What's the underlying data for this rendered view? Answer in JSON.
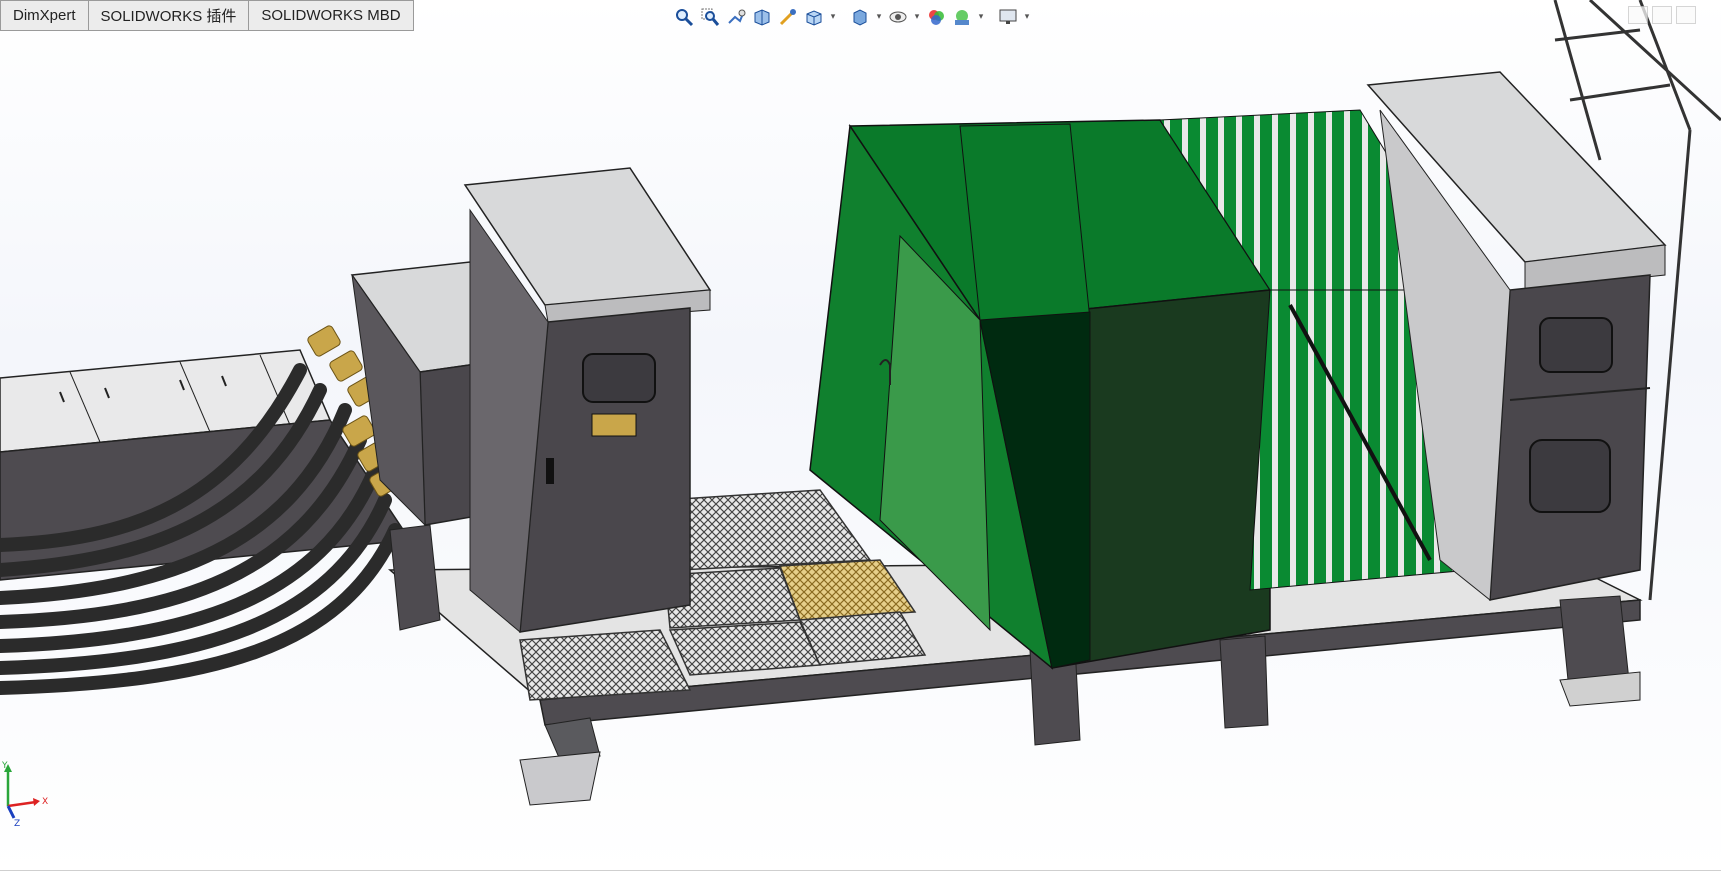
{
  "tabs": [
    {
      "label": "DimXpert"
    },
    {
      "label": "SOLIDWORKS 插件"
    },
    {
      "label": "SOLIDWORKS MBD"
    }
  ],
  "toolbar": {
    "icons": [
      "zoom-to-fit-icon",
      "zoom-to-area-icon",
      "previous-view-icon",
      "section-view-icon",
      "view-orientation-icon",
      "display-style-icon",
      "hide-show-items-icon",
      "edit-appearance-icon",
      "apply-scene-icon",
      "view-settings-icon"
    ]
  },
  "triad": {
    "x": "X",
    "y": "Y",
    "z": "Z"
  },
  "colors": {
    "cabinet_grey": "#4a474c",
    "cabinet_lid": "#d8d9da",
    "transformer_green": "#0a7a2a",
    "transformer_dark": "#1a3a1f",
    "cable": "#2b2b2b",
    "brass": "#c9a64a"
  }
}
